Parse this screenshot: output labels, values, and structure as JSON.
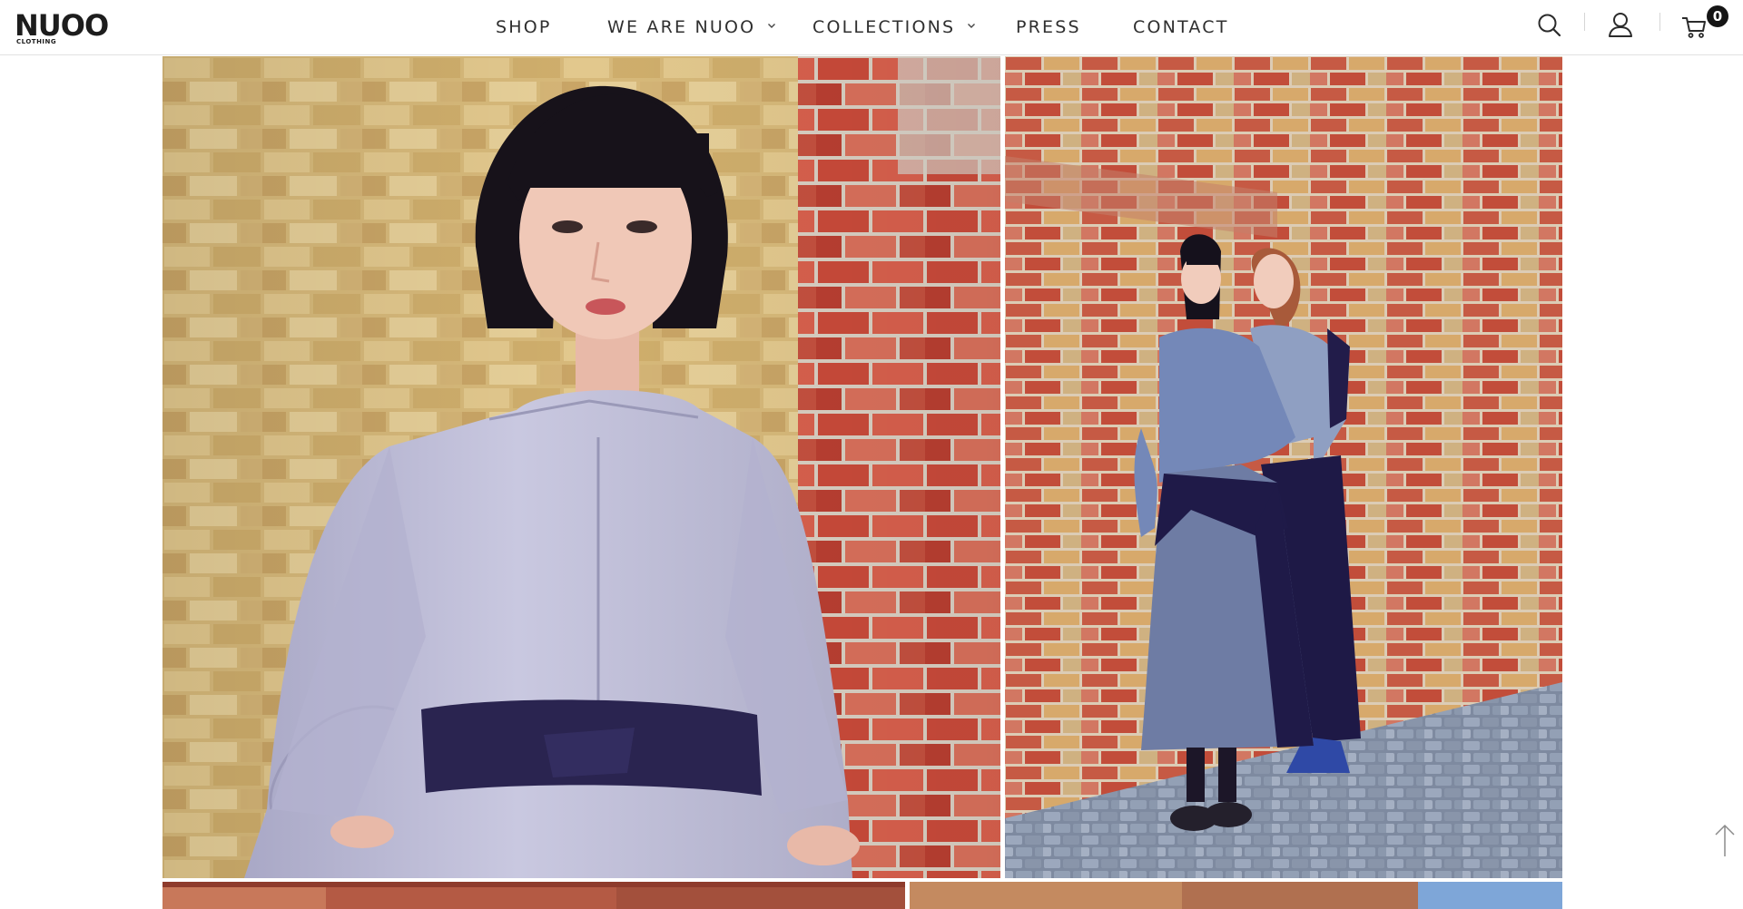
{
  "brand": {
    "name": "NUOO",
    "sub": "CLOTHING"
  },
  "nav": {
    "items": [
      {
        "label": "SHOP",
        "has_dropdown": false
      },
      {
        "label": "WE ARE NUOO",
        "has_dropdown": true
      },
      {
        "label": "COLLECTIONS",
        "has_dropdown": true
      },
      {
        "label": "PRESS",
        "has_dropdown": false
      },
      {
        "label": "CONTACT",
        "has_dropdown": false
      }
    ]
  },
  "header_actions": {
    "search_icon": "search-icon",
    "account_icon": "user-icon",
    "cart_icon": "cart-icon",
    "cart_count": "0"
  },
  "gallery": {
    "photos": [
      {
        "subject": "model-closeup-brick-wall",
        "alt": ""
      },
      {
        "subject": "two-models-brick-wall",
        "alt": ""
      },
      {
        "subject": "brick-wall-bottom-left",
        "alt": ""
      },
      {
        "subject": "street-bottom-right",
        "alt": ""
      }
    ]
  },
  "colors": {
    "text": "#2f2f2f",
    "border": "#e2e2e2",
    "badge": "#151515",
    "navy": "#1d1840",
    "brick": "#b6503a"
  },
  "scroll_top_icon": "arrow-up-icon"
}
